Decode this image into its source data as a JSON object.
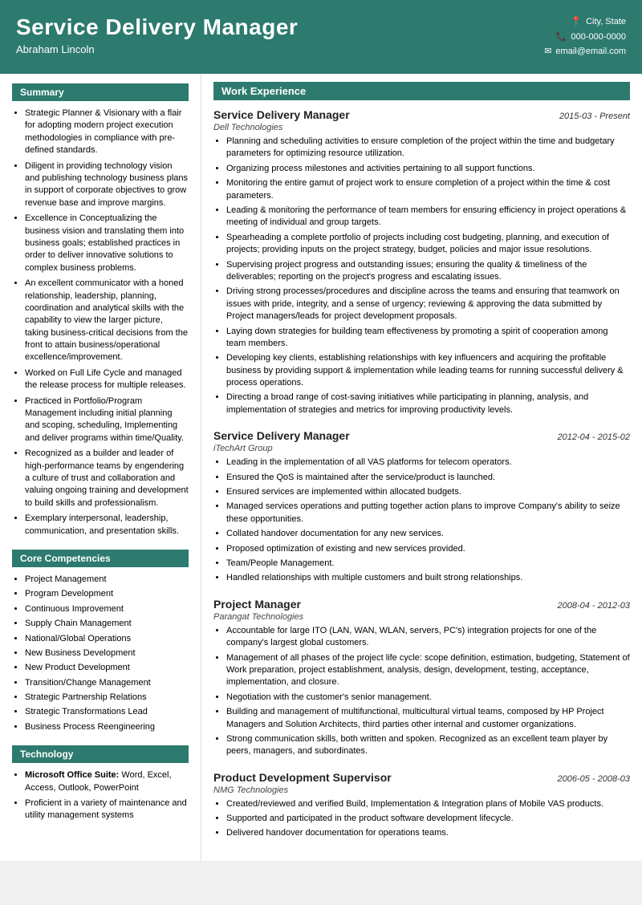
{
  "header": {
    "name": "Service Delivery Manager",
    "subtitle": "Abraham Lincoln",
    "contact": {
      "location": "City, State",
      "phone": "000-000-0000",
      "email": "email@email.com"
    }
  },
  "sidebar": {
    "summary_header": "Summary",
    "summary_items": [
      "Strategic Planner & Visionary with a flair for adopting modern project execution methodologies in compliance with pre-defined standards.",
      "Diligent in providing technology vision and publishing technology business plans in support of corporate objectives to grow revenue base and improve margins.",
      "Excellence in Conceptualizing the business vision and translating them into business goals; established practices in order to deliver innovative solutions to complex business problems.",
      "An excellent communicator with a honed relationship, leadership, planning, coordination and analytical skills with the capability to view the larger picture, taking business-critical decisions from the front to attain business/operational excellence/improvement.",
      "Worked on Full Life Cycle and managed the release process for multiple releases.",
      "Practiced in Portfolio/Program Management including initial planning and scoping, scheduling, Implementing and deliver programs within time/Quality.",
      "Recognized as a builder and leader of high-performance teams by engendering a culture of trust and collaboration and valuing ongoing training and development to build skills and professionalism.",
      "Exemplary interpersonal, leadership, communication, and presentation skills."
    ],
    "competencies_header": "Core Competencies",
    "competencies_items": [
      "Project Management",
      "Program Development",
      "Continuous Improvement",
      "Supply Chain Management",
      "National/Global Operations",
      "New Business Development",
      "New Product Development",
      "Transition/Change Management",
      "Strategic Partnership Relations",
      "Strategic Transformations Lead",
      "Business Process Reengineering"
    ],
    "technology_header": "Technology",
    "technology_items": [
      {
        "bold": "Microsoft Office Suite:",
        "text": " Word, Excel, Access, Outlook, PowerPoint"
      },
      {
        "bold": "",
        "text": "Proficient in a variety of maintenance and utility management systems"
      }
    ]
  },
  "work_experience": {
    "header": "Work Experience",
    "jobs": [
      {
        "title": "Service Delivery Manager",
        "dates": "2015-03 - Present",
        "company": "Dell Technologies",
        "bullets": [
          "Planning and scheduling activities to ensure completion of the project within the time and budgetary parameters for optimizing resource utilization.",
          "Organizing process milestones and activities pertaining to all support functions.",
          "Monitoring the entire gamut of project work to ensure completion of a project within the time & cost parameters.",
          "Leading & monitoring the performance of team members for ensuring efficiency in project operations & meeting of individual and group targets.",
          "Spearheading a complete portfolio of projects including cost budgeting, planning, and execution of projects; providing inputs on the project strategy, budget, policies and major issue resolutions.",
          "Supervising project progress and outstanding issues; ensuring the quality & timeliness of the deliverables; reporting on the project's progress and escalating issues.",
          "Driving strong processes/procedures and discipline across the teams and ensuring that teamwork on issues with pride, integrity, and a sense of urgency; reviewing & approving the data submitted by Project managers/leads for project development proposals.",
          "Laying down strategies for building team effectiveness by promoting a spirit of cooperation among team members.",
          "Developing key clients, establishing relationships with key influencers and acquiring the profitable business by providing support & implementation while leading teams for running successful delivery & process operations.",
          "Directing a broad range of cost-saving initiatives while participating in planning, analysis, and implementation of strategies and metrics for improving productivity levels."
        ]
      },
      {
        "title": "Service Delivery Manager",
        "dates": "2012-04 - 2015-02",
        "company": "iTechArt Group",
        "bullets": [
          "Leading in the implementation of all VAS platforms for telecom operators.",
          "Ensured the QoS is maintained after the service/product is launched.",
          "Ensured services are implemented within allocated budgets.",
          "Managed services operations and putting together action plans to improve Company's ability to seize these opportunities.",
          "Collated handover documentation for any new services.",
          "Proposed optimization of existing and new services provided.",
          "Team/People Management.",
          "Handled relationships with multiple customers and built strong relationships."
        ]
      },
      {
        "title": "Project Manager",
        "dates": "2008-04 - 2012-03",
        "company": "Parangat Technologies",
        "bullets": [
          "Accountable for large ITO (LAN, WAN, WLAN, servers, PC's) integration projects for one of the company's largest global customers.",
          "Management of all phases of the project life cycle: scope definition, estimation, budgeting, Statement of Work preparation, project establishment, analysis, design, development, testing, acceptance, implementation, and closure.",
          "Negotiation with the customer's senior management.",
          "Building and management of multifunctional, multicultural virtual teams, composed by HP Project Managers and Solution Architects, third parties other internal and customer organizations.",
          "Strong communication skills, both written and spoken. Recognized as an excellent team player by peers, managers, and subordinates."
        ]
      },
      {
        "title": "Product Development Supervisor",
        "dates": "2006-05 - 2008-03",
        "company": "NMG Technologies",
        "bullets": [
          "Created/reviewed and verified Build, Implementation & Integration plans of Mobile VAS products.",
          "Supported and participated in the product software development lifecycle.",
          "Delivered handover documentation for operations teams."
        ]
      }
    ]
  }
}
